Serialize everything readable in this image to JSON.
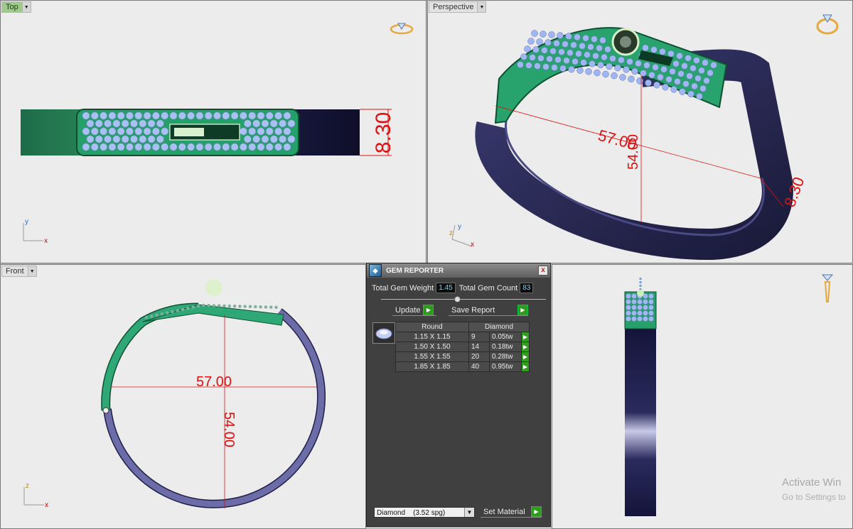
{
  "viewports": {
    "top": {
      "label": "Top",
      "dim_height": "8.30",
      "axis_y": "y",
      "axis_x": "x"
    },
    "perspective": {
      "label": "Perspective",
      "dim_width": "57.00",
      "dim_inner": "54.00",
      "dim_height": "8.30",
      "axis_y": "y",
      "axis_x": "x",
      "axis_z": "z"
    },
    "front": {
      "label": "Front",
      "dim_width": "57.00",
      "dim_inner": "54.00",
      "axis_z": "z",
      "axis_x": "x"
    },
    "right": {}
  },
  "gem_reporter": {
    "title": "GEM REPORTER",
    "close": "x",
    "total_weight_label": "Total Gem Weight",
    "total_weight": "1.45",
    "total_count_label": "Total Gem Count",
    "total_count": "83",
    "update_label": "Update",
    "save_report_label": "Save Report",
    "columns": [
      "Round",
      "Diamond"
    ],
    "rows": [
      {
        "size": "1.15 X 1.15",
        "count": "9",
        "weight": "0.05tw"
      },
      {
        "size": "1.50 X 1.50",
        "count": "14",
        "weight": "0.18tw"
      },
      {
        "size": "1.55 X 1.55",
        "count": "20",
        "weight": "0.28tw"
      },
      {
        "size": "1.85 X 1.85",
        "count": "40",
        "weight": "0.95tw"
      }
    ],
    "material": "Diamond    (3.52 spg)",
    "set_material_label": "Set Material"
  },
  "watermark": {
    "line1": "Activate Win",
    "line2": "Go to Settings to"
  },
  "colors": {
    "metal_green": "#2b9f6f",
    "metal_dark": "#1a1a3e",
    "gem_blue": "#9fb8f0",
    "dim_red": "#e01010",
    "viewport_bg": "#ececec"
  }
}
